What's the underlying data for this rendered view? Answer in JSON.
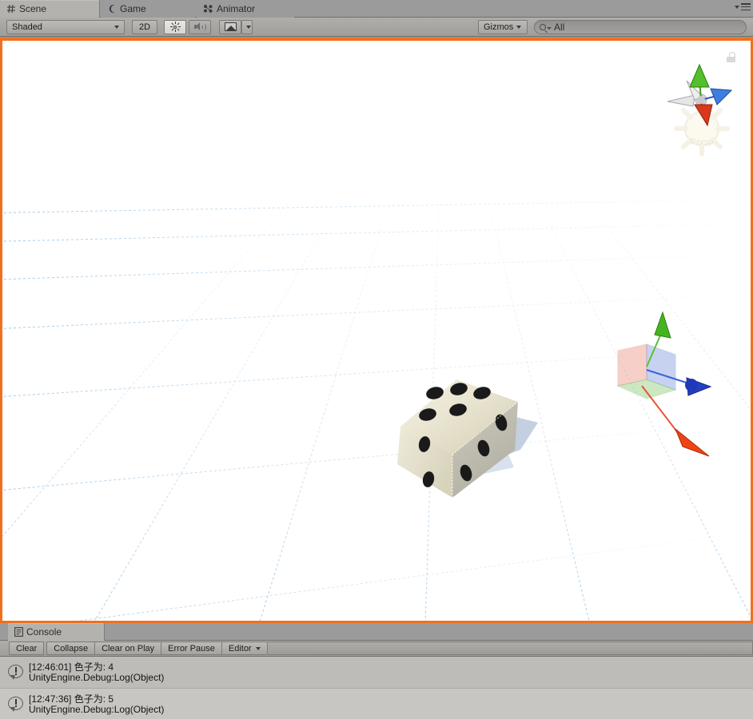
{
  "window": {
    "editor": "Unity Editor",
    "tabs": [
      {
        "id": "scene",
        "label": "Scene",
        "icon": "grid-hash-icon",
        "active": true
      },
      {
        "id": "game",
        "label": "Game",
        "icon": "gamepad-icon",
        "active": false
      },
      {
        "id": "animator",
        "label": "Animator",
        "icon": "animator-nodes-icon",
        "active": false
      }
    ],
    "menu_icon": "window-options-menu-icon"
  },
  "scene_toolbar": {
    "draw_mode": {
      "label": "Shaded",
      "icon": "chevron-down-icon"
    },
    "view_2d": {
      "label": "2D",
      "active": false
    },
    "lighting": {
      "label": "",
      "icon": "sun-icon",
      "active": true
    },
    "audio": {
      "label": "",
      "icon": "speaker-icon",
      "active": false
    },
    "effects": {
      "label": "",
      "icon": "image-icon",
      "active": false
    },
    "effects_dropdown": {
      "icon": "chevron-down-icon"
    },
    "gizmos": {
      "label": "Gizmos",
      "icon": "chevron-down-icon"
    },
    "search": {
      "value": "All",
      "placeholder": "All",
      "icon": "search-icon"
    }
  },
  "viewport": {
    "background_color": "#ffffff",
    "focus_border_color": "#f07020",
    "grid_color": "#cfe3f2",
    "lock_icon": "padlock-unlocked-icon",
    "scene_gizmo": {
      "label": "Persp",
      "axes": [
        {
          "name": "y-axis-cone",
          "color": "#4caf28"
        },
        {
          "name": "x-axis-cone",
          "color": "#d83a26"
        },
        {
          "name": "z-axis-cone",
          "color": "#2a7ede"
        },
        {
          "name": "negative-x-cone",
          "color": "#d9d9d9"
        },
        {
          "name": "negative-z-cone",
          "color": "#d9d9d9"
        }
      ],
      "overlay_icon": "directional-light-gizmo-icon"
    },
    "transform_gizmo": {
      "tool": "move",
      "axes": [
        {
          "name": "x-axis-arrow",
          "color": "#e8411f"
        },
        {
          "name": "y-axis-arrow",
          "color": "#4caf28"
        },
        {
          "name": "z-axis-arrow",
          "color": "#2246c8"
        }
      ]
    },
    "object": {
      "name": "dice-cube",
      "material": "marble",
      "top_face_pips": 5,
      "right_face_pips": 3,
      "left_face_pips": 2,
      "shadow_color": "#b7c4d8"
    }
  },
  "console": {
    "tab": {
      "label": "Console",
      "icon": "console-icon",
      "active": true
    },
    "toolbar": [
      {
        "id": "clear",
        "label": "Clear"
      },
      {
        "id": "collapse",
        "label": "Collapse"
      },
      {
        "id": "clear-on-play",
        "label": "Clear on Play"
      },
      {
        "id": "error-pause",
        "label": "Error Pause"
      },
      {
        "id": "editor",
        "label": "Editor",
        "icon": "chevron-down-icon"
      }
    ],
    "entries": [
      {
        "icon": "log-info-icon",
        "message": "[12:46:01] 色子为: 4",
        "stacktrace": "UnityEngine.Debug:Log(Object)",
        "timestamp": "12:46:01",
        "value": "4"
      },
      {
        "icon": "log-info-icon",
        "message": "[12:47:36] 色子为: 5",
        "stacktrace": "UnityEngine.Debug:Log(Object)",
        "timestamp": "12:47:36",
        "value": "5"
      }
    ]
  }
}
